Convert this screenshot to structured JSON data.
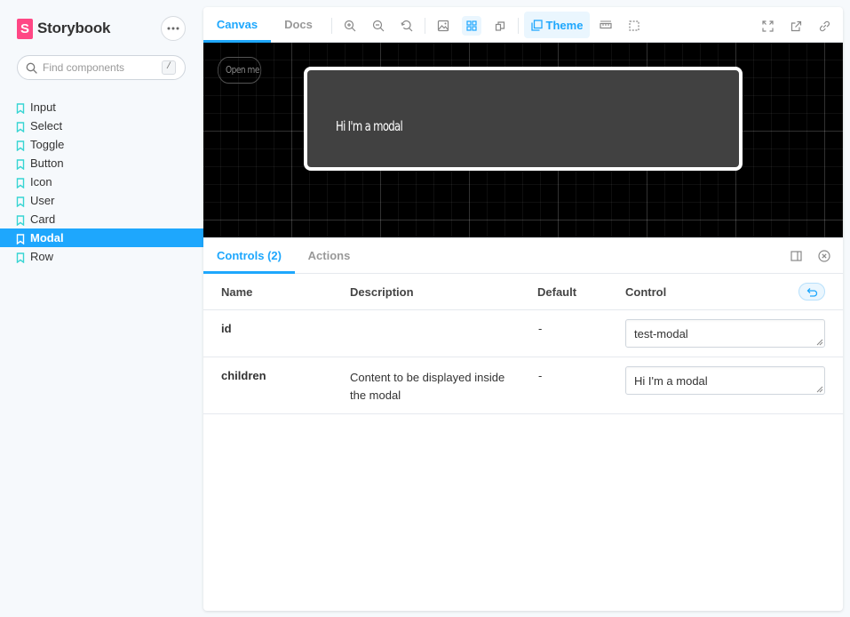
{
  "brand": {
    "name": "Storybook",
    "logo_letter": "S"
  },
  "search": {
    "placeholder": "Find components",
    "shortcut": "/"
  },
  "sidebar": {
    "items": [
      {
        "label": "Input",
        "active": false
      },
      {
        "label": "Select",
        "active": false
      },
      {
        "label": "Toggle",
        "active": false
      },
      {
        "label": "Button",
        "active": false
      },
      {
        "label": "Icon",
        "active": false
      },
      {
        "label": "User",
        "active": false
      },
      {
        "label": "Card",
        "active": false
      },
      {
        "label": "Modal",
        "active": true
      },
      {
        "label": "Row",
        "active": false
      }
    ]
  },
  "toolbar": {
    "tabs": [
      {
        "label": "Canvas",
        "active": true
      },
      {
        "label": "Docs",
        "active": false
      }
    ],
    "theme_label": "Theme"
  },
  "preview": {
    "open_button_label": "Open me",
    "modal_text": "Hi I'm a modal"
  },
  "addons": {
    "tabs": [
      {
        "label": "Controls (2)",
        "active": true
      },
      {
        "label": "Actions",
        "active": false
      }
    ]
  },
  "controls_table": {
    "headers": {
      "name": "Name",
      "description": "Description",
      "default": "Default",
      "control": "Control"
    },
    "rows": [
      {
        "name": "id",
        "description": "",
        "default": "-",
        "value": "test-modal"
      },
      {
        "name": "children",
        "description": "Content to be displayed inside the modal",
        "default": "-",
        "value": "Hi I'm a modal"
      }
    ]
  },
  "colors": {
    "accent": "#1ea7fd",
    "brand": "#ff4785",
    "canvas_bg": "#000000",
    "modal_bg": "#414141"
  }
}
